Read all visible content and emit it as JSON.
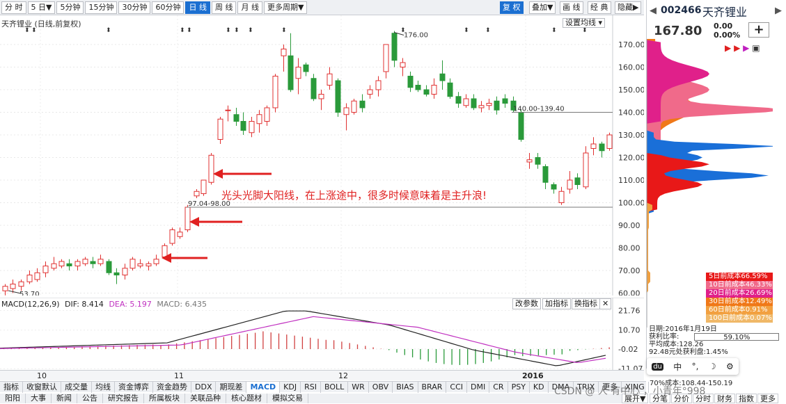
{
  "toolbar": {
    "periods": [
      "分 时",
      "5 日▼",
      "5分钟",
      "15分钟",
      "30分钟",
      "60分钟",
      "日 线",
      "周 线",
      "月 线",
      "更多周期▼"
    ],
    "active_period": "日 线",
    "right_buttons": [
      "复 权",
      "叠加▼",
      "画 线",
      "经 典",
      "隐藏▶"
    ],
    "active_right": "复 权"
  },
  "chart": {
    "title": "天齐锂业 (日线,前复权)",
    "settings_btn": "设置均线",
    "annotation": "光头光脚大阳线，在上涨途中，很多时候意味着是主升浪!",
    "high_label": "176.00",
    "low_label": "53.70",
    "hline1_label": "140.00-139.40",
    "hline2_label": "97.04-98.00",
    "y_axis": [
      "170.00",
      "160.00",
      "150.00",
      "140.00",
      "130.00",
      "120.00",
      "110.00",
      "100.00",
      "90.00",
      "80.00",
      "70.00",
      "60.00"
    ],
    "x_axis": [
      "10",
      "11",
      "12",
      "2016"
    ],
    "colors": {
      "up": "#e03030",
      "down": "#2a9a3a",
      "arrow": "#e02020"
    }
  },
  "macd": {
    "label": "MACD(12,26,9)",
    "dif": "DIF: 8.414",
    "dea": "DEA: 5.197",
    "macd": "MACD: 6.435",
    "buttons": [
      "改参数",
      "加指标",
      "换指标",
      "✕"
    ],
    "y_axis": [
      "21.76",
      "10.70",
      "-0.02",
      "-11.07"
    ]
  },
  "right_panel": {
    "code": "002466",
    "name": "天齐锂业",
    "price": "167.80",
    "change": "0.00",
    "change_pct": "0.00%",
    "plus": "+",
    "legend": [
      {
        "label": "5日前成本66.59%",
        "color": "#e81818"
      },
      {
        "label": "10日前成本46.33%",
        "color": "#f06a8a"
      },
      {
        "label": "20日前成本26.69%",
        "color": "#e0208a"
      },
      {
        "label": "30日前成本12.49%",
        "color": "#f07818"
      },
      {
        "label": "60日前成本0.91%",
        "color": "#f2a040"
      },
      {
        "label": "100日前成本0.07%",
        "color": "#f0b868"
      }
    ],
    "date": "日期:2016年1月19日",
    "profit_label": "获利比率:",
    "profit_value": "59.10%",
    "avg_cost": "平均成本:128.26",
    "winner": "92.48元处获利盘:1.45%",
    "cost70": "70%成本:108.44-150.19",
    "tools": [
      "du",
      "中",
      "°,",
      "☽",
      "⚙"
    ]
  },
  "indicator_tabs": [
    "指标",
    "收窗默认",
    "成交量",
    "均线",
    "资金博弈",
    "资金趋势",
    "DDX",
    "期现差",
    "MACD",
    "KDJ",
    "RSI",
    "BOLL",
    "WR",
    "OBV",
    "BIAS",
    "BRAR",
    "CCI",
    "DMI",
    "CR",
    "PSY",
    "KD",
    "DMA",
    "TRIX",
    "更多",
    "XING"
  ],
  "active_indicator": "MACD",
  "sub_tabs": [
    "阳阳",
    "大事",
    "新闻",
    "公告",
    "研究报告",
    "所属板块",
    "关联品种",
    "核心题材",
    "模拟交易"
  ],
  "right_sub_tabs": [
    "分笔",
    "分价",
    "分时",
    "财务",
    "指数",
    "更多"
  ],
  "right_sub_left": "展开▼",
  "watermark": "CSDN @ 人 有中心 ，小青年°998"
}
